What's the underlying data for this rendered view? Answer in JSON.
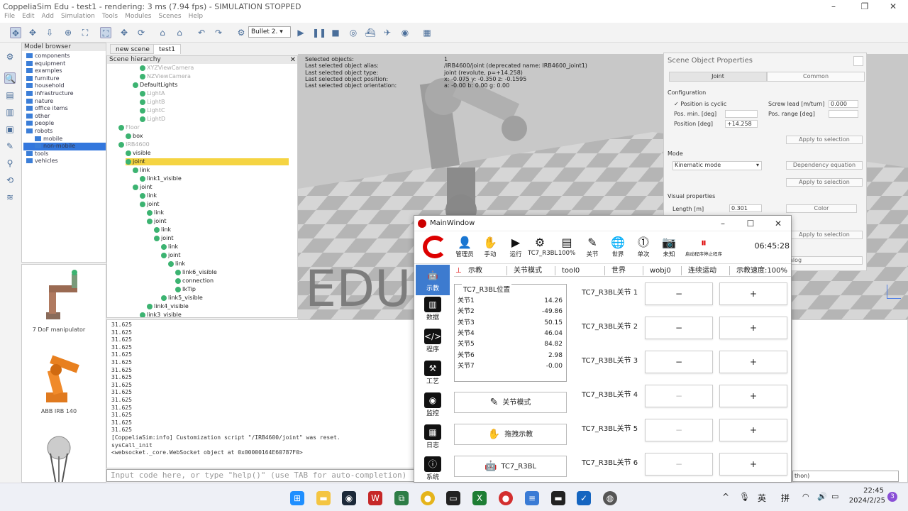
{
  "app": {
    "title": "CoppeliaSim Edu - test1 - rendering: 3 ms (7.94 fps) - SIMULATION STOPPED",
    "menu": [
      "File",
      "Edit",
      "Add",
      "Simulation",
      "Tools",
      "Modules",
      "Scenes",
      "Help"
    ],
    "engine": "Bullet 2."
  },
  "model_browser": {
    "title": "Model browser",
    "items": [
      "components",
      "equipment",
      "examples",
      "furniture",
      "household",
      "infrastructure",
      "nature",
      "office items",
      "other",
      "people",
      "robots",
      "mobile",
      "non-mobile",
      "tools",
      "vehicles"
    ],
    "thumbs": [
      "7 DoF manipulator",
      "ABB IRB 140",
      ""
    ]
  },
  "scene_tabs": [
    "new scene",
    "test1"
  ],
  "hierarchy": {
    "title": "Scene hierarchy",
    "rows": [
      "XYZViewCamera",
      "NZViewCamera",
      "DefaultLights",
      "LightA",
      "LightB",
      "LightC",
      "LightD",
      "Floor",
      "box",
      "IRB4600",
      "visible",
      "joint",
      "link",
      "link1_visible",
      "joint",
      "link",
      "joint",
      "link",
      "joint",
      "link",
      "joint",
      "link",
      "joint",
      "link",
      "link6_visible",
      "connection",
      "IkTip",
      "link5_visible",
      "link4_visible",
      "link3_visible"
    ]
  },
  "scene_info": {
    "labels": [
      "Selected objects:",
      "Last selected object alias:",
      "Last selected object type:",
      "Last selected object position:",
      "Last selected object orientation:"
    ],
    "values": [
      "1",
      "/IRB4600/joint   (deprecated name: IRB4600_joint1)",
      "joint (revolute, p=+14.258)",
      "x: -0.075   y: -0.350   z: -0.1595",
      "a: -0.00   b: 0.00   g: 0.00"
    ],
    "watermark": "EDU"
  },
  "console": {
    "lines": [
      "31.625",
      "31.625",
      "31.625",
      "31.625",
      "31.625",
      "31.625",
      "31.625",
      "31.625",
      "31.625",
      "31.625",
      "31.625",
      "31.625",
      "31.625",
      "31.625",
      "31.625",
      "[CoppeliaSim:info] Customization script \"/IRB4600/joint\" was reset.",
      "sysCall_init",
      "<websocket._core.WebSocket object at 0x00000164E60787F0>"
    ],
    "placeholder": "Input code here, or type \"help()\" (use TAB for auto-completion)"
  },
  "props": {
    "title": "Scene Object Properties",
    "tab_joint": "Joint",
    "tab_common": "Common",
    "configuration": "Configuration",
    "cyclic": "Position is cyclic",
    "screw_lead": "Screw lead [m/turn]",
    "screw_val": "0.000",
    "pos_min": "Pos. min. [deg]",
    "pos_range": "Pos. range [deg]",
    "position": "Position [deg]",
    "position_val": "+14.258",
    "apply": "Apply to selection",
    "mode": "Mode",
    "mode_val": "Kinematic mode",
    "dep_eq": "Dependency equation",
    "visual": "Visual properties",
    "length": "Length [m]",
    "length_val": "0.301",
    "color": "Color",
    "dialog_tail": "alog",
    "other_tail": "thon)"
  },
  "main_window": {
    "title": "MainWindow",
    "clock": "06:45:28",
    "top_buttons": [
      "管理员",
      "手动",
      "运行",
      "TC7_R3BL",
      "100%",
      "关节",
      "世界",
      "单次",
      "未知",
      "启动程序停止程序"
    ],
    "side": [
      "示教",
      "数据",
      "程序",
      "工艺",
      "监控",
      "日志",
      "系统"
    ],
    "jog_tabs": [
      "示教",
      "关节模式",
      "tool0",
      "世界",
      "wobj0",
      "连续运动",
      "示教速度:100%"
    ],
    "pos_title": "TC7_R3BL位置",
    "joints": [
      {
        "name": "关节1",
        "value": "14.26"
      },
      {
        "name": "关节2",
        "value": "-49.86"
      },
      {
        "name": "关节3",
        "value": "50.15"
      },
      {
        "name": "关节4",
        "value": "46.04"
      },
      {
        "name": "关节5",
        "value": "84.82"
      },
      {
        "name": "关节6",
        "value": "2.98"
      },
      {
        "name": "关节7",
        "value": "-0.00"
      }
    ],
    "mode_buttons": [
      "关节模式",
      "拖拽示教",
      "TC7_R3BL"
    ],
    "jog_rows": [
      "TC7_R3BL关节 1",
      "TC7_R3BL关节 2",
      "TC7_R3BL关节 3",
      "TC7_R3BL关节 4",
      "TC7_R3BL关节 5",
      "TC7_R3BL关节 6"
    ],
    "minus": "−",
    "plus": "+"
  },
  "tray": {
    "time": "22:45",
    "date": "2024/2/25",
    "ime1": "英",
    "ime2": "拼",
    "badge": "3"
  }
}
